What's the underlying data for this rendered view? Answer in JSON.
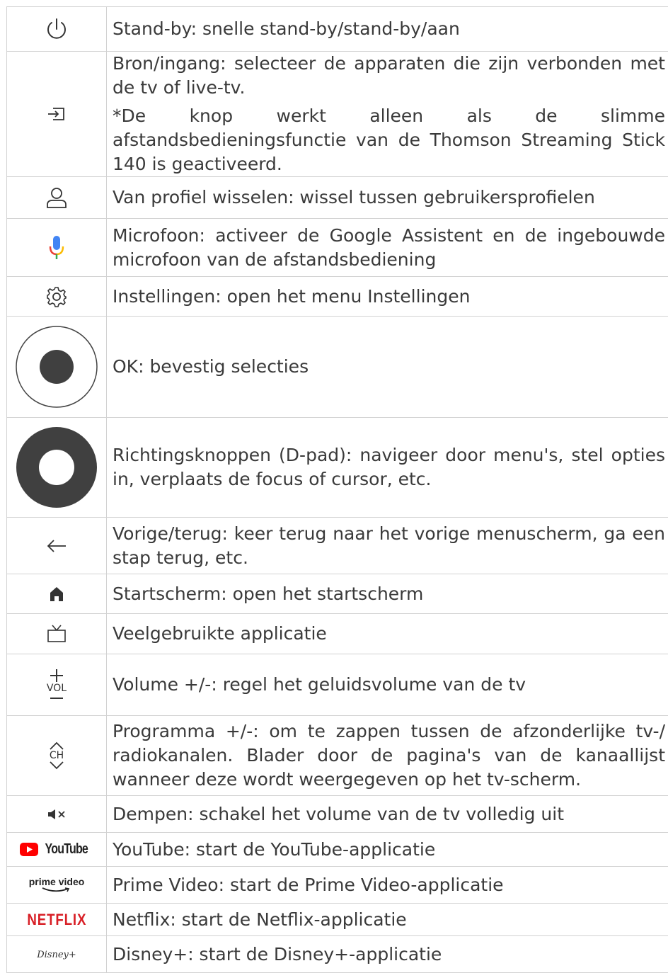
{
  "rows": [
    {
      "icon": "power-icon",
      "text": "Stand-by: snelle stand-by/stand-by/aan"
    },
    {
      "icon": "input-source-icon",
      "text": "Bron/ingang: selecteer de apparaten die zijn verbonden met de tv of live-tv.",
      "note": "*De knop werkt alleen als de slimme afstandsbedieningsfunctie van de Thomson Streaming Stick 140 is geactiveerd."
    },
    {
      "icon": "profile-icon",
      "text": "Van profiel wisselen: wissel tussen gebruikersprofielen"
    },
    {
      "icon": "microphone-icon",
      "text": "Microfoon: activeer de Google Assistent en de ingebouwde microfoon van de afstandsbediening"
    },
    {
      "icon": "settings-gear-icon",
      "text": "Instellingen: open het menu Instellingen"
    },
    {
      "icon": "ok-button-icon",
      "text": "OK: bevestig selecties"
    },
    {
      "icon": "dpad-icon",
      "text": "Richtingsknoppen (D-pad): navigeer door menu's, stel opties in, verplaats de focus of cursor, etc."
    },
    {
      "icon": "back-arrow-icon",
      "text": "Vorige/terug: keer terug naar het vorige menuscherm, ga een stap terug, etc."
    },
    {
      "icon": "home-icon",
      "text": "Startscherm: open het startscherm"
    },
    {
      "icon": "tv-app-icon",
      "text": "Veelgebruikte applicatie"
    },
    {
      "icon": "volume-icon",
      "icon_label": "VOL",
      "text": "Volume +/-: regel het geluidsvolume van de tv"
    },
    {
      "icon": "channel-icon",
      "icon_label": "CH",
      "text": "Programma +/-: om te zappen tussen de afzonderlijke tv-/ radiokanalen. Blader door de pagina's van de kanaallijst wanneer deze wordt weergegeven op het tv-scherm."
    },
    {
      "icon": "mute-icon",
      "text": "Dempen: schakel het volume van de tv volledig uit"
    },
    {
      "icon": "youtube-logo",
      "icon_label": "YouTube",
      "text": "YouTube: start de YouTube-applicatie"
    },
    {
      "icon": "prime-video-logo",
      "icon_label": "prime video",
      "text": "Prime Video: start de Prime Video-applicatie"
    },
    {
      "icon": "netflix-logo",
      "icon_label": "NETFLIX",
      "text": "Netflix: start de Netflix-applicatie"
    },
    {
      "icon": "disney-plus-logo",
      "icon_label": "Disney+",
      "text": "Disney+: start de Disney+-applicatie"
    }
  ],
  "colors": {
    "border": "#d2d2d2",
    "text": "#3a3a3a",
    "button_dark": "#404040",
    "netflix_red": "#d81f26",
    "youtube_red": "#ff0000",
    "prime_blue": "#00a8e1"
  }
}
